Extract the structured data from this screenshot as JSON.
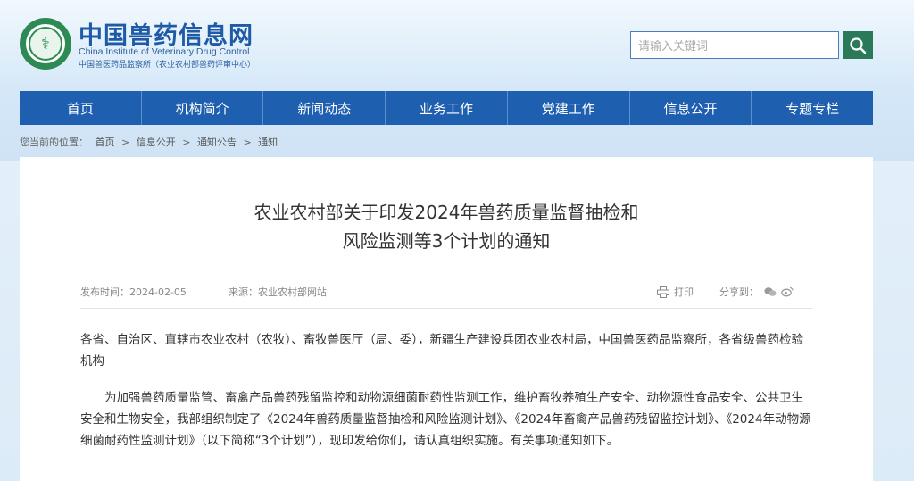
{
  "header": {
    "site_name": "中国兽药信息网",
    "site_name_en": "China Institute of Veterinary Drug Control",
    "site_sub": "中国兽医药品监察所（农业农村部兽药评审中心）",
    "logo_glyph": "⚕"
  },
  "search": {
    "placeholder": "请输入关键词",
    "button_icon": "search-icon"
  },
  "nav": {
    "items": [
      "首页",
      "机构简介",
      "新闻动态",
      "业务工作",
      "党建工作",
      "信息公开",
      "专题专栏"
    ]
  },
  "breadcrumb": {
    "prefix": "您当前的位置：",
    "items": [
      "首页",
      "信息公开",
      "通知公告",
      "通知"
    ],
    "separator": ">"
  },
  "article": {
    "title_line1": "农业农村部关于印发2024年兽药质量监督抽检和",
    "title_line2": "风险监测等3个计划的通知",
    "date_label": "发布时间：",
    "date": "2024-02-05",
    "source_label": "来源：",
    "source": "农业农村部网站",
    "print_label": "打印",
    "share_label": "分享到：",
    "para1": "各省、自治区、直辖市农业农村（农牧）、畜牧兽医厅（局、委），新疆生产建设兵团农业农村局，中国兽医药品监察所，各省级兽药检验机构",
    "para2": "为加强兽药质量监管、畜禽产品兽药残留监控和动物源细菌耐药性监测工作，维护畜牧养殖生产安全、动物源性食品安全、公共卫生安全和生物安全，我部组织制定了《2024年兽药质量监督抽检和风险监测计划》、《2024年畜禽产品兽药残留监控计划》、《2024年动物源细菌耐药性监测计划》（以下简称“3个计划”），现印发给你们，请认真组织实施。有关事项通知如下。"
  },
  "colors": {
    "nav_bg": "#1f5fb0",
    "search_btn": "#2a7a5a",
    "brand_blue": "#1e5aa6"
  }
}
